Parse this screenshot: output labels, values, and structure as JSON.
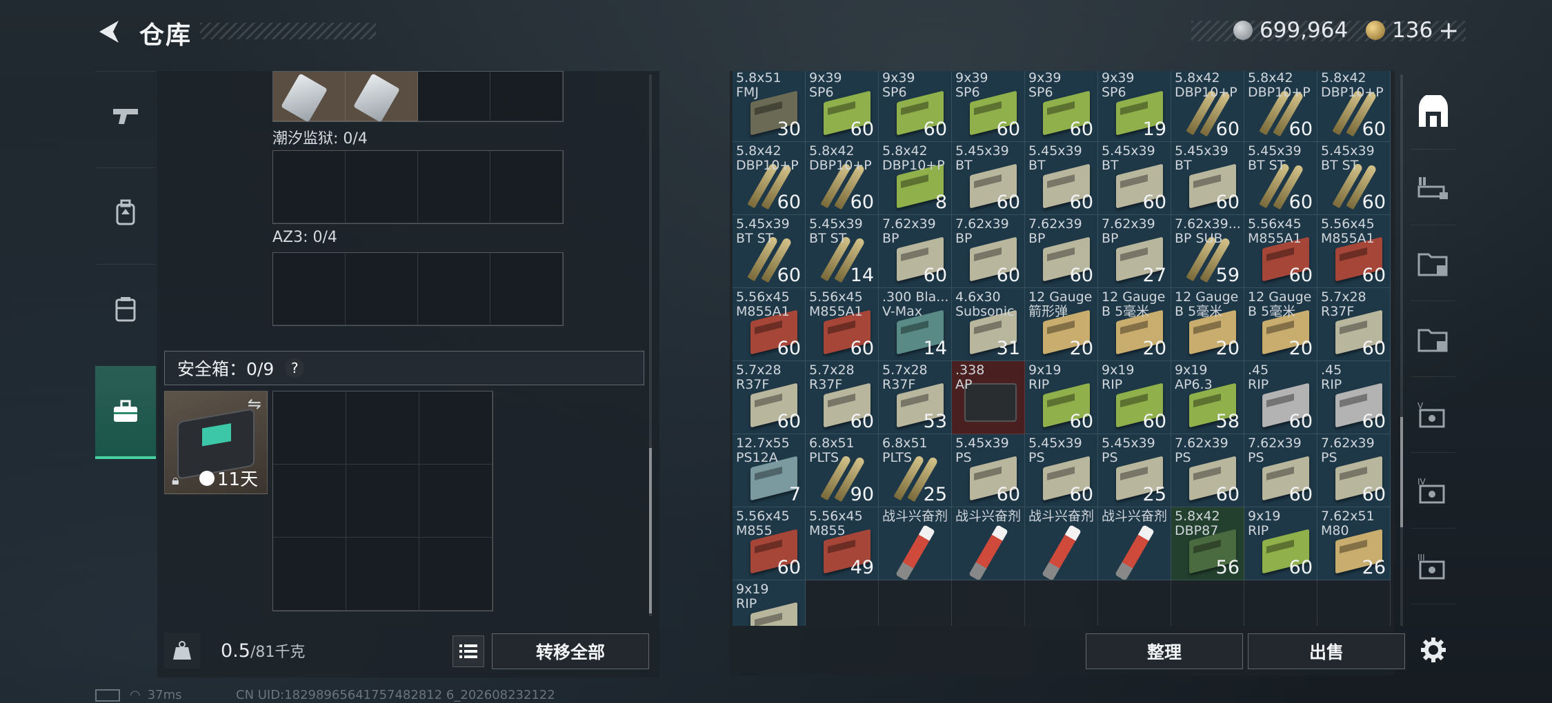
{
  "header": {
    "title": "仓库",
    "currency_silver": "699,964",
    "currency_gold": "136",
    "add_label": "+"
  },
  "left_sidebar": {
    "items": [
      {
        "icon": "pistol-icon"
      },
      {
        "icon": "backpack-icon"
      },
      {
        "icon": "vest-icon"
      },
      {
        "icon": "briefcase-icon",
        "active": true
      }
    ]
  },
  "containers": {
    "tide_prison_label": "潮汐监狱: 0/4",
    "az3_label": "AZ3: 0/4"
  },
  "safebox": {
    "title": "安全箱：0/9",
    "help": "?",
    "timer": "11天"
  },
  "bottom_left": {
    "weight_value": "0.5",
    "weight_unit": "/81千克",
    "transfer_all": "转移全部"
  },
  "bottom_right": {
    "sort": "整理",
    "sell": "出售"
  },
  "status": {
    "ping": "37ms",
    "uid": "CN UID:18298965641757482812 6_202608232122"
  },
  "colors": {
    "accent_green": "#48d0a0",
    "cell_blue": "#1e3848"
  },
  "items": [
    {
      "name": "5.8x51\nFMJ",
      "qty": "30",
      "type": "box",
      "color": "#6b6a55"
    },
    {
      "name": "9x39\nSP6",
      "qty": "60",
      "type": "box",
      "color": "#8fb04a"
    },
    {
      "name": "9x39\nSP6",
      "qty": "60",
      "type": "box",
      "color": "#8fb04a"
    },
    {
      "name": "9x39\nSP6",
      "qty": "60",
      "type": "box",
      "color": "#8fb04a"
    },
    {
      "name": "9x39\nSP6",
      "qty": "60",
      "type": "box",
      "color": "#8fb04a"
    },
    {
      "name": "9x39\nSP6",
      "qty": "19",
      "type": "box",
      "color": "#8fb04a"
    },
    {
      "name": "5.8x42\nDBP10+P",
      "qty": "60",
      "type": "bullet",
      "color": ""
    },
    {
      "name": "5.8x42\nDBP10+P",
      "qty": "60",
      "type": "bullet",
      "color": ""
    },
    {
      "name": "5.8x42\nDBP10+P",
      "qty": "60",
      "type": "bullet",
      "color": ""
    },
    {
      "name": "5.8x42\nDBP10+P",
      "qty": "60",
      "type": "bullet",
      "color": ""
    },
    {
      "name": "5.8x42\nDBP10+P",
      "qty": "60",
      "type": "bullet",
      "color": ""
    },
    {
      "name": "5.8x42\nDBP10+P",
      "qty": "8",
      "type": "box",
      "color": "#8fb04a"
    },
    {
      "name": "5.45x39\nBT",
      "qty": "60",
      "type": "box",
      "color": "#b9b69e"
    },
    {
      "name": "5.45x39\nBT",
      "qty": "60",
      "type": "box",
      "color": "#b9b69e"
    },
    {
      "name": "5.45x39\nBT",
      "qty": "60",
      "type": "box",
      "color": "#b9b69e"
    },
    {
      "name": "5.45x39\nBT",
      "qty": "60",
      "type": "box",
      "color": "#b9b69e"
    },
    {
      "name": "5.45x39\nBT ST",
      "qty": "60",
      "type": "bullet",
      "color": ""
    },
    {
      "name": "5.45x39\nBT ST",
      "qty": "60",
      "type": "bullet",
      "color": ""
    },
    {
      "name": "5.45x39\nBT ST",
      "qty": "60",
      "type": "bullet",
      "color": ""
    },
    {
      "name": "5.45x39\nBT ST",
      "qty": "14",
      "type": "bullet",
      "color": ""
    },
    {
      "name": "7.62x39\nBP",
      "qty": "60",
      "type": "box",
      "color": "#b9b69e"
    },
    {
      "name": "7.62x39\nBP",
      "qty": "60",
      "type": "box",
      "color": "#b9b69e"
    },
    {
      "name": "7.62x39\nBP",
      "qty": "60",
      "type": "box",
      "color": "#b9b69e"
    },
    {
      "name": "7.62x39\nBP",
      "qty": "27",
      "type": "box",
      "color": "#b9b69e"
    },
    {
      "name": "7.62x39...\nBP SUB",
      "qty": "59",
      "type": "bullet",
      "color": ""
    },
    {
      "name": "5.56x45\nM855A1",
      "qty": "60",
      "type": "box",
      "color": "#a64638"
    },
    {
      "name": "5.56x45\nM855A1",
      "qty": "60",
      "type": "box",
      "color": "#a64638"
    },
    {
      "name": "5.56x45\nM855A1",
      "qty": "60",
      "type": "box",
      "color": "#a64638"
    },
    {
      "name": "5.56x45\nM855A1",
      "qty": "60",
      "type": "box",
      "color": "#a64638"
    },
    {
      "name": ".300 Bla...\nV-Max",
      "qty": "14",
      "type": "box",
      "color": "#5a8a86"
    },
    {
      "name": "4.6x30\nSubsonic",
      "qty": "31",
      "type": "box",
      "color": "#b9b69e"
    },
    {
      "name": "12 Gauge\n箭形弹",
      "qty": "20",
      "type": "box",
      "color": "#c9ad6e"
    },
    {
      "name": "12 Gauge\nB 5毫米",
      "qty": "20",
      "type": "box",
      "color": "#c9ad6e"
    },
    {
      "name": "12 Gauge\nB 5毫米",
      "qty": "20",
      "type": "box",
      "color": "#c9ad6e"
    },
    {
      "name": "12 Gauge\nB 5毫米",
      "qty": "20",
      "type": "box",
      "color": "#c9ad6e"
    },
    {
      "name": "5.7x28\nR37F",
      "qty": "60",
      "type": "box",
      "color": "#b9b69e"
    },
    {
      "name": "5.7x28\nR37F",
      "qty": "60",
      "type": "box",
      "color": "#b9b69e"
    },
    {
      "name": "5.7x28\nR37F",
      "qty": "60",
      "type": "box",
      "color": "#b9b69e"
    },
    {
      "name": "5.7x28\nR37F",
      "qty": "53",
      "type": "box",
      "color": "#b9b69e"
    },
    {
      "name": ".338\nAP",
      "qty": "",
      "type": "case",
      "color": "",
      "rarity": "red"
    },
    {
      "name": "9x19\nRIP",
      "qty": "60",
      "type": "box",
      "color": "#8fb04a"
    },
    {
      "name": "9x19\nRIP",
      "qty": "60",
      "type": "box",
      "color": "#8fb04a"
    },
    {
      "name": "9x19\nAP6.3",
      "qty": "58",
      "type": "box",
      "color": "#8fb04a"
    },
    {
      "name": ".45\nRIP",
      "qty": "60",
      "type": "box",
      "color": "#b3b3b3"
    },
    {
      "name": ".45\nRIP",
      "qty": "60",
      "type": "box",
      "color": "#b3b3b3"
    },
    {
      "name": "12.7x55\nPS12A",
      "qty": "7",
      "type": "box",
      "color": "#7a9aa0"
    },
    {
      "name": "6.8x51\nPLTS",
      "qty": "90",
      "type": "bullet",
      "color": ""
    },
    {
      "name": "6.8x51\nPLTS",
      "qty": "25",
      "type": "bullet",
      "color": ""
    },
    {
      "name": "5.45x39\nPS",
      "qty": "60",
      "type": "box",
      "color": "#b9b69e"
    },
    {
      "name": "5.45x39\nPS",
      "qty": "60",
      "type": "box",
      "color": "#b9b69e"
    },
    {
      "name": "5.45x39\nPS",
      "qty": "25",
      "type": "box",
      "color": "#b9b69e"
    },
    {
      "name": "7.62x39\nPS",
      "qty": "60",
      "type": "box",
      "color": "#b9b69e"
    },
    {
      "name": "7.62x39\nPS",
      "qty": "60",
      "type": "box",
      "color": "#b9b69e"
    },
    {
      "name": "7.62x39\nPS",
      "qty": "60",
      "type": "box",
      "color": "#b9b69e"
    },
    {
      "name": "5.56x45\nM855",
      "qty": "60",
      "type": "box",
      "color": "#a64638"
    },
    {
      "name": "5.56x45\nM855",
      "qty": "49",
      "type": "box",
      "color": "#a64638"
    },
    {
      "name": "战斗兴奋剂",
      "qty": "",
      "type": "syringe",
      "color": ""
    },
    {
      "name": "战斗兴奋剂",
      "qty": "",
      "type": "syringe",
      "color": ""
    },
    {
      "name": "战斗兴奋剂",
      "qty": "",
      "type": "syringe",
      "color": ""
    },
    {
      "name": "战斗兴奋剂",
      "qty": "",
      "type": "syringe",
      "color": ""
    },
    {
      "name": "5.8x42\nDBP87",
      "qty": "56",
      "type": "box",
      "color": "#4a6a3f",
      "rarity": "green"
    },
    {
      "name": "9x19\nRIP",
      "qty": "60",
      "type": "box",
      "color": "#8fb04a"
    },
    {
      "name": "7.62x51\nM80",
      "qty": "26",
      "type": "box",
      "color": "#c9ad6e"
    },
    {
      "name": "9x19\nRIP",
      "qty": "",
      "type": "box",
      "color": "#b9b69e"
    }
  ]
}
